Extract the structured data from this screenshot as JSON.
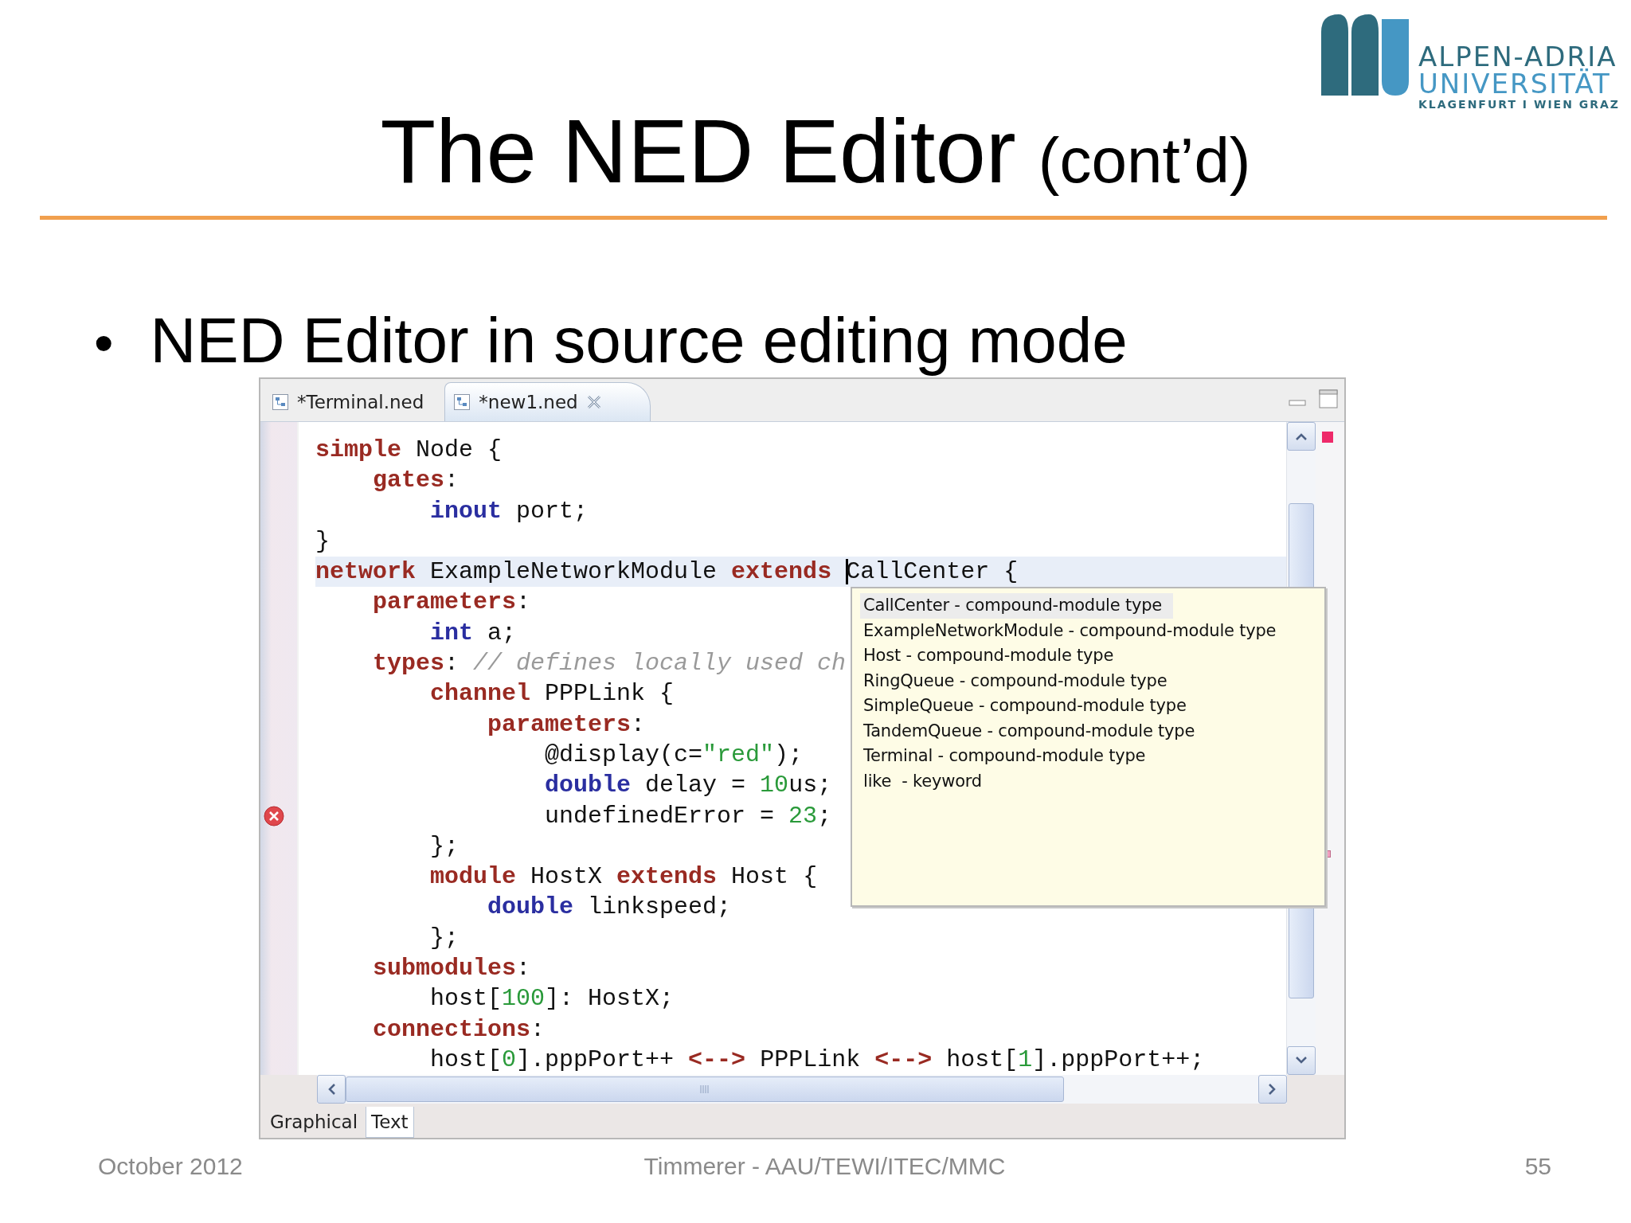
{
  "logo": {
    "line1": "ALPEN-ADRIA",
    "line2": "UNIVERSITÄT",
    "line3": "KLAGENFURT I WIEN GRAZ"
  },
  "title": {
    "main": "The NED Editor",
    "suffix": "(cont’d)"
  },
  "bullets": [
    {
      "marker": "•",
      "text": "NED Editor in source editing mode"
    }
  ],
  "editor": {
    "tabs": [
      {
        "label": "*Terminal.ned",
        "selected": false,
        "closable": false
      },
      {
        "label": "*new1.ned",
        "selected": true,
        "closable": true
      }
    ],
    "code_lines": [
      {
        "tokens": [
          {
            "kind": "kw",
            "text": "simple"
          },
          {
            "kind": "plain",
            "text": " Node {"
          }
        ]
      },
      {
        "tokens": [
          {
            "kind": "kw",
            "text": "    gates"
          },
          {
            "kind": "plain",
            "text": ":"
          }
        ]
      },
      {
        "tokens": [
          {
            "kind": "type",
            "text": "        inout"
          },
          {
            "kind": "plain",
            "text": " port;"
          }
        ]
      },
      {
        "tokens": [
          {
            "kind": "plain",
            "text": "}"
          }
        ]
      },
      {
        "current": true,
        "tokens": [
          {
            "kind": "kw",
            "text": "network"
          },
          {
            "kind": "plain",
            "text": " ExampleNetworkModule "
          },
          {
            "kind": "kw",
            "text": "extends "
          },
          {
            "kind": "plain",
            "text": "CallCenter {",
            "caret": true
          }
        ]
      },
      {
        "tokens": [
          {
            "kind": "kw",
            "text": "    parameters"
          },
          {
            "kind": "plain",
            "text": ":"
          }
        ]
      },
      {
        "tokens": [
          {
            "kind": "type",
            "text": "        int"
          },
          {
            "kind": "plain",
            "text": " a;"
          }
        ]
      },
      {
        "tokens": [
          {
            "kind": "kw",
            "text": "    types"
          },
          {
            "kind": "plain",
            "text": ": "
          },
          {
            "kind": "comment",
            "text": "// defines locally used ch"
          }
        ]
      },
      {
        "tokens": [
          {
            "kind": "kw",
            "text": "        channel"
          },
          {
            "kind": "plain",
            "text": " PPPLink {"
          }
        ]
      },
      {
        "tokens": [
          {
            "kind": "kw",
            "text": "            parameters"
          },
          {
            "kind": "plain",
            "text": ":"
          }
        ]
      },
      {
        "tokens": [
          {
            "kind": "plain",
            "text": "                @display(c="
          },
          {
            "kind": "literal",
            "text": "\"red\""
          },
          {
            "kind": "plain",
            "text": ");"
          }
        ]
      },
      {
        "tokens": [
          {
            "kind": "type",
            "text": "                double"
          },
          {
            "kind": "plain",
            "text": " delay = "
          },
          {
            "kind": "literal",
            "text": "10"
          },
          {
            "kind": "plain",
            "text": "us;"
          }
        ]
      },
      {
        "error": true,
        "tokens": [
          {
            "kind": "plain",
            "text": "                undefinedError = "
          },
          {
            "kind": "literal",
            "text": "23"
          },
          {
            "kind": "plain",
            "text": ";"
          }
        ]
      },
      {
        "tokens": [
          {
            "kind": "plain",
            "text": "        };"
          }
        ]
      },
      {
        "tokens": [
          {
            "kind": "kw",
            "text": "        module"
          },
          {
            "kind": "plain",
            "text": " HostX "
          },
          {
            "kind": "kw",
            "text": "extends"
          },
          {
            "kind": "plain",
            "text": " Host {"
          }
        ]
      },
      {
        "tokens": [
          {
            "kind": "type",
            "text": "            double"
          },
          {
            "kind": "plain",
            "text": " linkspeed;"
          }
        ]
      },
      {
        "tokens": [
          {
            "kind": "plain",
            "text": "        };"
          }
        ]
      },
      {
        "tokens": [
          {
            "kind": "kw",
            "text": "    submodules"
          },
          {
            "kind": "plain",
            "text": ":"
          }
        ]
      },
      {
        "tokens": [
          {
            "kind": "plain",
            "text": "        host["
          },
          {
            "kind": "literal",
            "text": "100"
          },
          {
            "kind": "plain",
            "text": "]: HostX;"
          }
        ]
      },
      {
        "tokens": [
          {
            "kind": "kw",
            "text": "    connections"
          },
          {
            "kind": "plain",
            "text": ":"
          }
        ]
      },
      {
        "tokens": [
          {
            "kind": "plain",
            "text": "        host["
          },
          {
            "kind": "literal",
            "text": "0"
          },
          {
            "kind": "plain",
            "text": "].pppPort++ "
          },
          {
            "kind": "kw",
            "text": "<-->"
          },
          {
            "kind": "plain",
            "text": " PPPLink "
          },
          {
            "kind": "kw",
            "text": "<-->"
          },
          {
            "kind": "plain",
            "text": " host["
          },
          {
            "kind": "literal",
            "text": "1"
          },
          {
            "kind": "plain",
            "text": "].pppPort++;"
          }
        ]
      }
    ],
    "completion": {
      "items": [
        {
          "label": "CallCenter - compound-module type",
          "selected": true
        },
        {
          "label": "ExampleNetworkModule - compound-module type",
          "selected": false
        },
        {
          "label": "Host - compound-module type",
          "selected": false
        },
        {
          "label": "RingQueue - compound-module type",
          "selected": false
        },
        {
          "label": "SimpleQueue - compound-module type",
          "selected": false
        },
        {
          "label": "TandemQueue - compound-module type",
          "selected": false
        },
        {
          "label": "Terminal - compound-module type",
          "selected": false
        },
        {
          "label": "like  - keyword",
          "selected": false
        }
      ]
    },
    "bottom_tabs": [
      {
        "label": "Graphical",
        "selected": false
      },
      {
        "label": "Text",
        "selected": true
      }
    ]
  },
  "footer": {
    "date": "October 2012",
    "author": "Timmerer - AAU/TEWI/ITEC/MMC",
    "page": "55"
  }
}
